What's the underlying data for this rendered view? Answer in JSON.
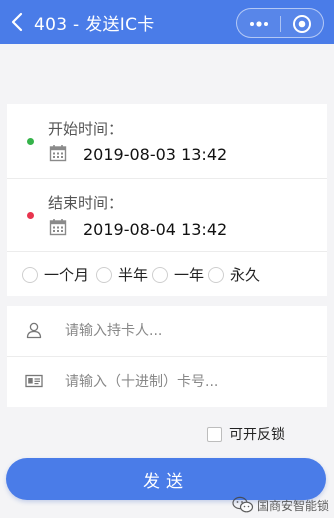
{
  "header": {
    "title": "403 - 发送IC卡",
    "accent_color": "#4a7ce8",
    "icons": [
      "chevron-left-icon",
      "more-dots-icon",
      "target-icon"
    ]
  },
  "time": {
    "start": {
      "label": "开始时间：",
      "value": "2019-08-03 13:42",
      "dot_color": "#35b34a",
      "icon": "calendar-icon"
    },
    "end": {
      "label": "结束时间：",
      "value": "2019-08-04 13:42",
      "dot_color": "#e8344e",
      "icon": "calendar-icon"
    }
  },
  "durations": [
    {
      "label": "一个月",
      "selected": false
    },
    {
      "label": "半年",
      "selected": false
    },
    {
      "label": "一年",
      "selected": false
    },
    {
      "label": "永久",
      "selected": false
    }
  ],
  "inputs": {
    "holder": {
      "placeholder": "请输入持卡人...",
      "value": "",
      "icon": "person-icon"
    },
    "card_number": {
      "placeholder": "请输入（十进制）卡号...",
      "value": "",
      "icon": "id-card-icon"
    }
  },
  "options": {
    "reversible_label": "可开反锁",
    "reversible_checked": false
  },
  "submit_label": "发送",
  "watermark": {
    "text": "国商安智能锁",
    "icon": "wechat-icon"
  }
}
